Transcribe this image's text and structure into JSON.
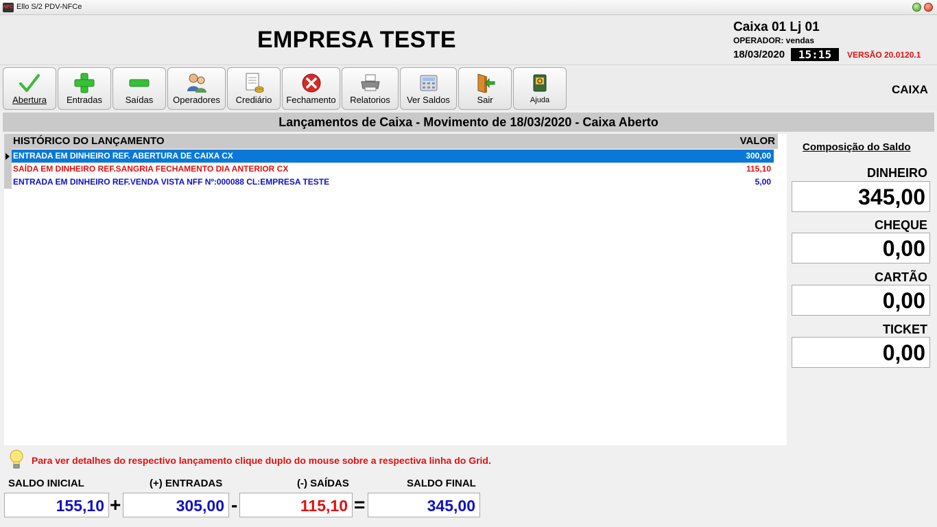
{
  "window": {
    "title": "Ello S/2 PDV-NFCe",
    "icon_text": "NFC"
  },
  "header": {
    "company": "EMPRESA TESTE",
    "caixa_loja": "Caixa 01 Lj 01",
    "operador": "OPERADOR: vendas",
    "data": "18/03/2020",
    "hora": "15:15",
    "versao": "VERSÃO 20.0120.1"
  },
  "toolbar": {
    "buttons": [
      {
        "label": "Abertura",
        "icon": "check-icon"
      },
      {
        "label": "Entradas",
        "icon": "plus-icon"
      },
      {
        "label": "Saídas",
        "icon": "minus-icon"
      },
      {
        "label": "Operadores",
        "icon": "users-icon"
      },
      {
        "label": "Crediário",
        "icon": "document-coins-icon"
      },
      {
        "label": "Fechamento",
        "icon": "close-circle-icon"
      },
      {
        "label": "Relatorios",
        "icon": "printer-icon"
      },
      {
        "label": "Ver Saldos",
        "icon": "calculator-icon"
      },
      {
        "label": "Sair",
        "icon": "exit-door-icon"
      },
      {
        "label": "Ajuda",
        "icon": "help-book-icon"
      }
    ],
    "right_label": "CAIXA"
  },
  "section_title": "Lançamentos de Caixa - Movimento de 18/03/2020 - Caixa Aberto",
  "grid": {
    "col_historico": "HISTÓRICO DO LANÇAMENTO",
    "col_valor": "VALOR",
    "rows": [
      {
        "historico": "ENTRADA EM DINHEIRO REF. ABERTURA DE CAIXA CX",
        "valor": "300,00",
        "style": "selected"
      },
      {
        "historico": "SAÍDA EM DINHEIRO REF.SANGRIA FECHAMENTO DIA ANTERIOR CX",
        "valor": "115,10",
        "style": "red"
      },
      {
        "historico": "ENTRADA EM DINHEIRO REF.VENDA VISTA NFF Nº:000088 CL:EMPRESA TESTE",
        "valor": "5,00",
        "style": "blue"
      }
    ]
  },
  "composicao": {
    "title": "Composição do Saldo",
    "dinheiro_label": "DINHEIRO",
    "dinheiro": "345,00",
    "cheque_label": "CHEQUE",
    "cheque": "0,00",
    "cartao_label": "CARTÃO",
    "cartao": "0,00",
    "ticket_label": "TICKET",
    "ticket": "0,00"
  },
  "hint": "Para ver detalhes do respectivo lançamento clique duplo do mouse sobre a respectiva linha do Grid.",
  "totais": {
    "saldo_inicial_label": "SALDO INICIAL",
    "saldo_inicial": "155,10",
    "entradas_label": "(+) ENTRADAS",
    "entradas": "305,00",
    "saidas_label": "(-) SAÍDAS",
    "saidas": "115,10",
    "saldo_final_label": "SALDO FINAL",
    "saldo_final": "345,00",
    "op_plus": "+",
    "op_minus": "-",
    "op_equal": "="
  },
  "colors": {
    "selected_row": "#0a78d8",
    "red": "#e01010",
    "blue": "#1010c8"
  }
}
